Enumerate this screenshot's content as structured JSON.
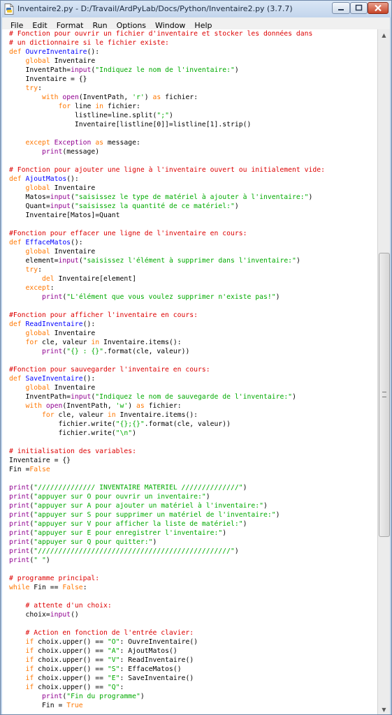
{
  "window": {
    "title": "Inventaire2.py - D:/Travail/ArdPyLab/Docs/Python/Inventaire2.py (3.7.7)"
  },
  "colors": {
    "comment": "#dd0000",
    "keyword": "#ff7700",
    "builtin": "#900090",
    "string": "#00aa00",
    "definition": "#0000ff",
    "normal": "#000000"
  },
  "icons": {
    "app": "idle-file-icon",
    "minimize": "minimize-icon",
    "maximize": "maximize-icon",
    "close": "close-icon",
    "scroll_up": "scroll-up-arrow-icon",
    "scroll_down": "scroll-down-arrow-icon"
  },
  "menu": [
    {
      "label": "File"
    },
    {
      "label": "Edit"
    },
    {
      "label": "Format"
    },
    {
      "label": "Run"
    },
    {
      "label": "Options"
    },
    {
      "label": "Window"
    },
    {
      "label": "Help"
    }
  ],
  "code_lines": [
    [
      [
        "c",
        "# Fonction pour ouvrir un fichier d'inventaire et stocker les données dans"
      ]
    ],
    [
      [
        "c",
        "# un dictionnaire si le fichier existe:"
      ]
    ],
    [
      [
        "k",
        "def "
      ],
      [
        "d",
        "OuvreInventaire"
      ],
      [
        "n",
        "():"
      ]
    ],
    [
      [
        "n",
        "    "
      ],
      [
        "k",
        "global"
      ],
      [
        "n",
        " Inventaire"
      ]
    ],
    [
      [
        "n",
        "    InventPath="
      ],
      [
        "b",
        "input"
      ],
      [
        "n",
        "("
      ],
      [
        "s",
        "\"Indiquez le nom de l'inventaire:\""
      ],
      [
        "n",
        ")"
      ]
    ],
    [
      [
        "n",
        "    Inventaire = {}"
      ]
    ],
    [
      [
        "n",
        "    "
      ],
      [
        "k",
        "try"
      ],
      [
        "n",
        ":"
      ]
    ],
    [
      [
        "n",
        "        "
      ],
      [
        "k",
        "with"
      ],
      [
        "n",
        " "
      ],
      [
        "b",
        "open"
      ],
      [
        "n",
        "(InventPath, "
      ],
      [
        "s",
        "'r'"
      ],
      [
        "n",
        ") "
      ],
      [
        "k",
        "as"
      ],
      [
        "n",
        " fichier:"
      ]
    ],
    [
      [
        "n",
        "            "
      ],
      [
        "k",
        "for"
      ],
      [
        "n",
        " line "
      ],
      [
        "k",
        "in"
      ],
      [
        "n",
        " fichier:"
      ]
    ],
    [
      [
        "n",
        "                listline=line.split("
      ],
      [
        "s",
        "\";\""
      ],
      [
        "n",
        ")"
      ]
    ],
    [
      [
        "n",
        "                Inventaire[listline[0]]=listline[1].strip()"
      ]
    ],
    [
      [
        "n",
        ""
      ]
    ],
    [
      [
        "n",
        "    "
      ],
      [
        "k",
        "except"
      ],
      [
        "n",
        " "
      ],
      [
        "b",
        "Exception"
      ],
      [
        "n",
        " "
      ],
      [
        "k",
        "as"
      ],
      [
        "n",
        " message:"
      ]
    ],
    [
      [
        "n",
        "        "
      ],
      [
        "b",
        "print"
      ],
      [
        "n",
        "(message)"
      ]
    ],
    [
      [
        "n",
        ""
      ]
    ],
    [
      [
        "c",
        "# Fonction pour ajouter une ligne à l'inventaire ouvert ou initialement vide:"
      ]
    ],
    [
      [
        "k",
        "def "
      ],
      [
        "d",
        "AjoutMatos"
      ],
      [
        "n",
        "():"
      ]
    ],
    [
      [
        "n",
        "    "
      ],
      [
        "k",
        "global"
      ],
      [
        "n",
        " Inventaire"
      ]
    ],
    [
      [
        "n",
        "    Matos="
      ],
      [
        "b",
        "input"
      ],
      [
        "n",
        "("
      ],
      [
        "s",
        "\"saisissez le type de matériel à ajouter à l'inventaire:\""
      ],
      [
        "n",
        ")"
      ]
    ],
    [
      [
        "n",
        "    Quant="
      ],
      [
        "b",
        "input"
      ],
      [
        "n",
        "("
      ],
      [
        "s",
        "\"saisissez la quantité de ce matériel:\""
      ],
      [
        "n",
        ")"
      ]
    ],
    [
      [
        "n",
        "    Inventaire[Matos]=Quant"
      ]
    ],
    [
      [
        "n",
        ""
      ]
    ],
    [
      [
        "c",
        "#Fonction pour effacer une ligne de l'inventaire en cours:"
      ]
    ],
    [
      [
        "k",
        "def "
      ],
      [
        "d",
        "EffaceMatos"
      ],
      [
        "n",
        "():"
      ]
    ],
    [
      [
        "n",
        "    "
      ],
      [
        "k",
        "global"
      ],
      [
        "n",
        " Inventaire"
      ]
    ],
    [
      [
        "n",
        "    element="
      ],
      [
        "b",
        "input"
      ],
      [
        "n",
        "("
      ],
      [
        "s",
        "\"saisissez l'élément à supprimer dans l'inventaire:\""
      ],
      [
        "n",
        ")"
      ]
    ],
    [
      [
        "n",
        "    "
      ],
      [
        "k",
        "try"
      ],
      [
        "n",
        ":"
      ]
    ],
    [
      [
        "n",
        "        "
      ],
      [
        "k",
        "del"
      ],
      [
        "n",
        " Inventaire[element]"
      ]
    ],
    [
      [
        "n",
        "    "
      ],
      [
        "k",
        "except"
      ],
      [
        "n",
        ":"
      ]
    ],
    [
      [
        "n",
        "        "
      ],
      [
        "b",
        "print"
      ],
      [
        "n",
        "("
      ],
      [
        "s",
        "\"L'élément que vous voulez supprimer n'existe pas!\""
      ],
      [
        "n",
        ")"
      ]
    ],
    [
      [
        "n",
        ""
      ]
    ],
    [
      [
        "c",
        "#Fonction pour afficher l'inventaire en cours:"
      ]
    ],
    [
      [
        "k",
        "def "
      ],
      [
        "d",
        "ReadInventaire"
      ],
      [
        "n",
        "():"
      ]
    ],
    [
      [
        "n",
        "    "
      ],
      [
        "k",
        "global"
      ],
      [
        "n",
        " Inventaire"
      ]
    ],
    [
      [
        "n",
        "    "
      ],
      [
        "k",
        "for"
      ],
      [
        "n",
        " cle, valeur "
      ],
      [
        "k",
        "in"
      ],
      [
        "n",
        " Inventaire.items():"
      ]
    ],
    [
      [
        "n",
        "        "
      ],
      [
        "b",
        "print"
      ],
      [
        "n",
        "("
      ],
      [
        "s",
        "\"{} : {}\""
      ],
      [
        "n",
        ".format(cle, valeur))"
      ]
    ],
    [
      [
        "n",
        ""
      ]
    ],
    [
      [
        "c",
        "#Fonction pour sauvegarder l'inventaire en cours:"
      ]
    ],
    [
      [
        "k",
        "def "
      ],
      [
        "d",
        "SaveInventaire"
      ],
      [
        "n",
        "():"
      ]
    ],
    [
      [
        "n",
        "    "
      ],
      [
        "k",
        "global"
      ],
      [
        "n",
        " Inventaire"
      ]
    ],
    [
      [
        "n",
        "    InventPath="
      ],
      [
        "b",
        "input"
      ],
      [
        "n",
        "("
      ],
      [
        "s",
        "\"Indiquez le nom de sauvegarde de l'inventaire:\""
      ],
      [
        "n",
        ")"
      ]
    ],
    [
      [
        "n",
        "    "
      ],
      [
        "k",
        "with"
      ],
      [
        "n",
        " "
      ],
      [
        "b",
        "open"
      ],
      [
        "n",
        "(InventPath, "
      ],
      [
        "s",
        "'w'"
      ],
      [
        "n",
        ") "
      ],
      [
        "k",
        "as"
      ],
      [
        "n",
        " fichier:"
      ]
    ],
    [
      [
        "n",
        "        "
      ],
      [
        "k",
        "for"
      ],
      [
        "n",
        " cle, valeur "
      ],
      [
        "k",
        "in"
      ],
      [
        "n",
        " Inventaire.items():"
      ]
    ],
    [
      [
        "n",
        "            fichier.write("
      ],
      [
        "s",
        "\"{};{}\""
      ],
      [
        "n",
        ".format(cle, valeur))"
      ]
    ],
    [
      [
        "n",
        "            fichier.write("
      ],
      [
        "s",
        "\"\\n\""
      ],
      [
        "n",
        ")"
      ]
    ],
    [
      [
        "n",
        ""
      ]
    ],
    [
      [
        "c",
        "# initialisation des variables:"
      ]
    ],
    [
      [
        "n",
        "Inventaire = {}"
      ]
    ],
    [
      [
        "n",
        "Fin ="
      ],
      [
        "k",
        "False"
      ]
    ],
    [
      [
        "n",
        ""
      ]
    ],
    [
      [
        "b",
        "print"
      ],
      [
        "n",
        "("
      ],
      [
        "s",
        "\"////////////// INVENTAIRE MATERIEL //////////////\""
      ],
      [
        "n",
        ")"
      ]
    ],
    [
      [
        "b",
        "print"
      ],
      [
        "n",
        "("
      ],
      [
        "s",
        "\"appuyer sur O pour ouvrir un inventaire:\""
      ],
      [
        "n",
        ")"
      ]
    ],
    [
      [
        "b",
        "print"
      ],
      [
        "n",
        "("
      ],
      [
        "s",
        "\"appuyer sur A pour ajouter un matériel à l'inventaire:\""
      ],
      [
        "n",
        ")"
      ]
    ],
    [
      [
        "b",
        "print"
      ],
      [
        "n",
        "("
      ],
      [
        "s",
        "\"appuyer sur S pour supprimer un matériel de l'inventaire:\""
      ],
      [
        "n",
        ")"
      ]
    ],
    [
      [
        "b",
        "print"
      ],
      [
        "n",
        "("
      ],
      [
        "s",
        "\"appuyer sur V pour afficher la liste de matériel:\""
      ],
      [
        "n",
        ")"
      ]
    ],
    [
      [
        "b",
        "print"
      ],
      [
        "n",
        "("
      ],
      [
        "s",
        "\"appuyer sur E pour enregistrer l'inventaire:\""
      ],
      [
        "n",
        ")"
      ]
    ],
    [
      [
        "b",
        "print"
      ],
      [
        "n",
        "("
      ],
      [
        "s",
        "\"appuyer sur Q pour quitter:\""
      ],
      [
        "n",
        ")"
      ]
    ],
    [
      [
        "b",
        "print"
      ],
      [
        "n",
        "("
      ],
      [
        "s",
        "\"///////////////////////////////////////////////\""
      ],
      [
        "n",
        ")"
      ]
    ],
    [
      [
        "b",
        "print"
      ],
      [
        "n",
        "("
      ],
      [
        "s",
        "\" \""
      ],
      [
        "n",
        ")"
      ]
    ],
    [
      [
        "n",
        ""
      ]
    ],
    [
      [
        "c",
        "# programme principal:"
      ]
    ],
    [
      [
        "k",
        "while"
      ],
      [
        "n",
        " Fin == "
      ],
      [
        "k",
        "False"
      ],
      [
        "n",
        ":"
      ]
    ],
    [
      [
        "n",
        ""
      ]
    ],
    [
      [
        "n",
        "    "
      ],
      [
        "c",
        "# attente d'un choix:"
      ]
    ],
    [
      [
        "n",
        "    choix="
      ],
      [
        "b",
        "input"
      ],
      [
        "n",
        "()"
      ]
    ],
    [
      [
        "n",
        ""
      ]
    ],
    [
      [
        "n",
        "    "
      ],
      [
        "c",
        "# Action en fonction de l'entrée clavier:"
      ]
    ],
    [
      [
        "n",
        "    "
      ],
      [
        "k",
        "if"
      ],
      [
        "n",
        " choix.upper() == "
      ],
      [
        "s",
        "\"O\""
      ],
      [
        "n",
        ": OuvreInventaire()"
      ]
    ],
    [
      [
        "n",
        "    "
      ],
      [
        "k",
        "if"
      ],
      [
        "n",
        " choix.upper() == "
      ],
      [
        "s",
        "\"A\""
      ],
      [
        "n",
        ": AjoutMatos()"
      ]
    ],
    [
      [
        "n",
        "    "
      ],
      [
        "k",
        "if"
      ],
      [
        "n",
        " choix.upper() == "
      ],
      [
        "s",
        "\"V\""
      ],
      [
        "n",
        ": ReadInventaire()"
      ]
    ],
    [
      [
        "n",
        "    "
      ],
      [
        "k",
        "if"
      ],
      [
        "n",
        " choix.upper() == "
      ],
      [
        "s",
        "\"S\""
      ],
      [
        "n",
        ": EffaceMatos()"
      ]
    ],
    [
      [
        "n",
        "    "
      ],
      [
        "k",
        "if"
      ],
      [
        "n",
        " choix.upper() == "
      ],
      [
        "s",
        "\"E\""
      ],
      [
        "n",
        ": SaveInventaire()"
      ]
    ],
    [
      [
        "n",
        "    "
      ],
      [
        "k",
        "if"
      ],
      [
        "n",
        " choix.upper() == "
      ],
      [
        "s",
        "\"Q\""
      ],
      [
        "n",
        ":"
      ]
    ],
    [
      [
        "n",
        "        "
      ],
      [
        "b",
        "print"
      ],
      [
        "n",
        "("
      ],
      [
        "s",
        "\"Fin du programme\""
      ],
      [
        "n",
        ")"
      ]
    ],
    [
      [
        "n",
        "        Fin = "
      ],
      [
        "k",
        "True"
      ]
    ]
  ]
}
